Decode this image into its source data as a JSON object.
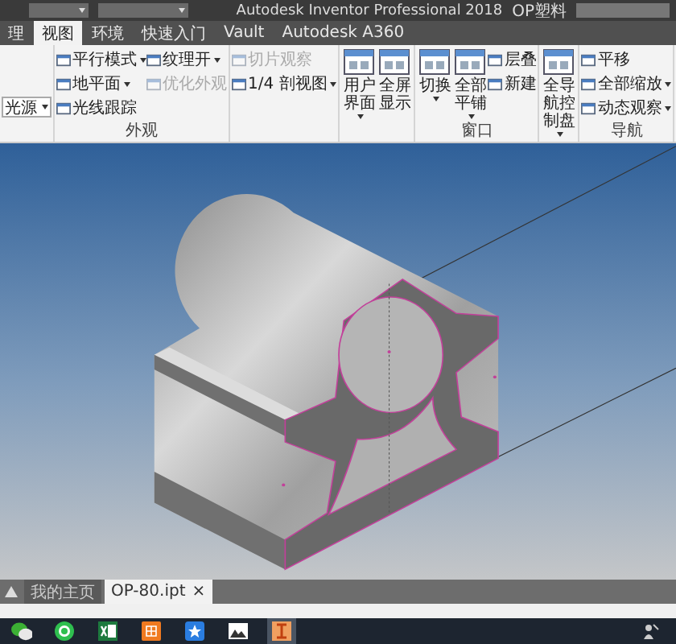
{
  "title_bar": {
    "title": "Autodesk Inventor Professional 2018",
    "document": "OP塑料"
  },
  "ribbon_tabs": [
    {
      "label": "理",
      "selected": false
    },
    {
      "label": "视图",
      "selected": true
    },
    {
      "label": "环境",
      "selected": false
    },
    {
      "label": "快速入门",
      "selected": false
    },
    {
      "label": "Vault",
      "selected": false
    },
    {
      "label": "Autodesk A360",
      "selected": false
    }
  ],
  "ribbon_groups": [
    {
      "columns": [
        [
          {
            "kind": "dropdown",
            "label": "光源",
            "dropdown": true,
            "disabled": false
          }
        ]
      ]
    },
    {
      "label": "外观",
      "columns": [
        [
          {
            "kind": "small",
            "label": "平行模式",
            "dropdown": true,
            "disabled": false
          },
          {
            "kind": "small",
            "label": "地平面",
            "dropdown": true,
            "disabled": false
          },
          {
            "kind": "small",
            "label": "光线跟踪",
            "dropdown": false,
            "disabled": false
          }
        ],
        [
          {
            "kind": "small",
            "label": "纹理开",
            "dropdown": true,
            "disabled": false
          },
          {
            "kind": "small",
            "label": "优化外观",
            "dropdown": false,
            "disabled": true
          }
        ]
      ]
    },
    {
      "columns": [
        [
          {
            "kind": "small",
            "label": "切片观察",
            "dropdown": false,
            "disabled": true
          },
          {
            "kind": "small",
            "label": "1/4 剖视图",
            "dropdown": true,
            "disabled": false
          }
        ]
      ]
    },
    {
      "columns": [
        [
          {
            "kind": "large",
            "label": "用户界面",
            "dropdown": true,
            "disabled": false
          }
        ],
        [
          {
            "kind": "large",
            "label": "全屏显示",
            "dropdown": false,
            "disabled": false
          }
        ]
      ]
    },
    {
      "label": "窗口",
      "columns": [
        [
          {
            "kind": "large",
            "label": "切换",
            "dropdown": true,
            "disabled": false
          }
        ],
        [
          {
            "kind": "large",
            "label": "全部平铺",
            "dropdown": true,
            "disabled": false
          }
        ],
        [
          {
            "kind": "small",
            "label": "层叠",
            "dropdown": false,
            "disabled": false
          },
          {
            "kind": "small",
            "label": "新建",
            "dropdown": false,
            "disabled": false
          }
        ]
      ]
    },
    {
      "columns": [
        [
          {
            "kind": "large",
            "label": "全导航控制盘",
            "dropdown": true,
            "disabled": false
          }
        ]
      ]
    },
    {
      "label": "导航",
      "columns": [
        [
          {
            "kind": "small",
            "label": "平移",
            "dropdown": false,
            "disabled": false
          },
          {
            "kind": "small",
            "label": "全部缩放",
            "dropdown": true,
            "disabled": false
          },
          {
            "kind": "small",
            "label": "动态观察",
            "dropdown": true,
            "disabled": false
          }
        ]
      ]
    }
  ],
  "document_tabs": [
    {
      "label": "我的主页",
      "selected": false
    },
    {
      "label": "OP-80.ipt",
      "selected": true,
      "close": "×"
    }
  ],
  "taskbar": {
    "apps": [
      {
        "kind": "chat",
        "selected": false
      },
      {
        "kind": "phone",
        "selected": false
      },
      {
        "kind": "sheet",
        "selected": false
      },
      {
        "kind": "grid",
        "selected": false
      },
      {
        "kind": "star",
        "selected": false
      },
      {
        "kind": "image",
        "selected": false
      },
      {
        "kind": "cad",
        "selected": true
      }
    ]
  }
}
